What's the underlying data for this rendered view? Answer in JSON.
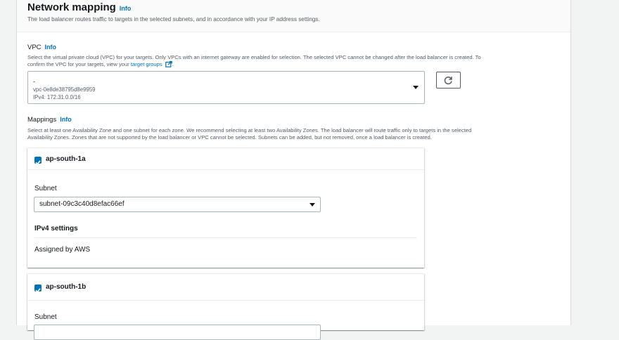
{
  "section": {
    "title": "Network mapping",
    "info_label": "Info",
    "description": "The load balancer routes traffic to targets in the selected subnets, and in accordance with your IP address settings."
  },
  "vpc": {
    "label": "VPC",
    "info_label": "Info",
    "description_line1": "Select the virtual private cloud (VPC) for your targets. Only VPCs with an internet gateway are enabled for selection. The selected VPC cannot be changed after the load balancer is created. To",
    "description_line2_prefix": "confirm the VPC for your targets, view your",
    "target_groups_link": "target groups",
    "description_line2_suffix": ".",
    "selected": {
      "name": "-",
      "id": "vpc-0e8de38795d8e9959",
      "cidr": "IPv4: 172.31.0.0/16"
    }
  },
  "mappings": {
    "label": "Mappings",
    "info_label": "Info",
    "description_line1": "Select at least one Availability Zone and one subnet for each zone. We recommend selecting at least two Availability Zones. The load balancer will route traffic only to targets in the selected",
    "description_line2": "Availability Zones. Zones that are not supported by the load balancer or VPC cannot be selected. Subnets can be added, but not removed, once a load balancer is created.",
    "zones": [
      {
        "name": "ap-south-1a",
        "checked": true,
        "subnet_label": "Subnet",
        "subnet_value": "subnet-09c3c40d8efac66ef",
        "ipv4_title": "IPv4 settings",
        "ipv4_value": "Assigned by AWS"
      },
      {
        "name": "ap-south-1b",
        "checked": true,
        "subnet_label": "Subnet"
      }
    ]
  },
  "colors": {
    "link": "#0073bb",
    "checkbox": "#0073bb",
    "text": "#16191f",
    "muted": "#545b64"
  }
}
